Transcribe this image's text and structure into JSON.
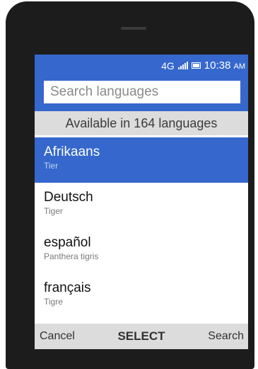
{
  "status_bar": {
    "network": "4G",
    "signal_icon": "signal-bars-icon",
    "battery_icon": "battery-icon",
    "time": "10:38",
    "meridiem": "AM"
  },
  "search": {
    "placeholder": "Search languages",
    "value": ""
  },
  "header": {
    "available_text": "Available in 164 languages"
  },
  "languages": [
    {
      "name": "Afrikaans",
      "translation": "Tier",
      "selected": true
    },
    {
      "name": "Deutsch",
      "translation": "Tiger",
      "selected": false
    },
    {
      "name": "español",
      "translation": "Panthera tigris",
      "selected": false
    },
    {
      "name": "français",
      "translation": "Tigre",
      "selected": false
    }
  ],
  "softkeys": {
    "left": "Cancel",
    "center": "SELECT",
    "right": "Search"
  },
  "colors": {
    "accent": "#3567cd",
    "band": "#dcdcdc",
    "device": "#1c1c1c"
  }
}
